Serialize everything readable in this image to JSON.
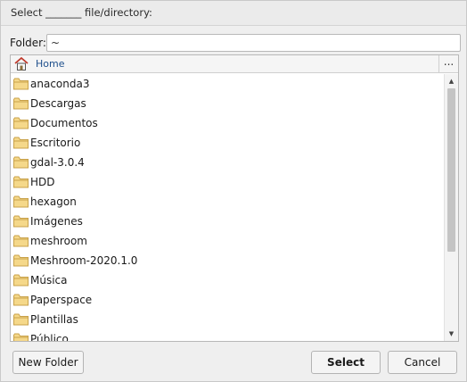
{
  "window": {
    "title": "Select _______ file/directory:"
  },
  "folder": {
    "label": "Folder:",
    "value": "~"
  },
  "breadcrumb": {
    "home_label": "Home",
    "more_label": "..."
  },
  "items": [
    {
      "label": "anaconda3"
    },
    {
      "label": "Descargas"
    },
    {
      "label": "Documentos"
    },
    {
      "label": "Escritorio"
    },
    {
      "label": "gdal-3.0.4"
    },
    {
      "label": "HDD"
    },
    {
      "label": "hexagon"
    },
    {
      "label": "Imágenes"
    },
    {
      "label": "meshroom"
    },
    {
      "label": "Meshroom-2020.1.0"
    },
    {
      "label": "Música"
    },
    {
      "label": "Paperspace"
    },
    {
      "label": "Plantillas"
    },
    {
      "label": "Público"
    }
  ],
  "scrollbar": {
    "up_icon": "▲",
    "down_icon": "▼"
  },
  "buttons": {
    "new_folder": "New Folder",
    "select": "Select",
    "cancel": "Cancel"
  },
  "colors": {
    "folder_fill": "#f5d88a",
    "folder_stroke": "#c9a24a",
    "home_roof": "#c0392b",
    "link": "#1e4f8c"
  }
}
